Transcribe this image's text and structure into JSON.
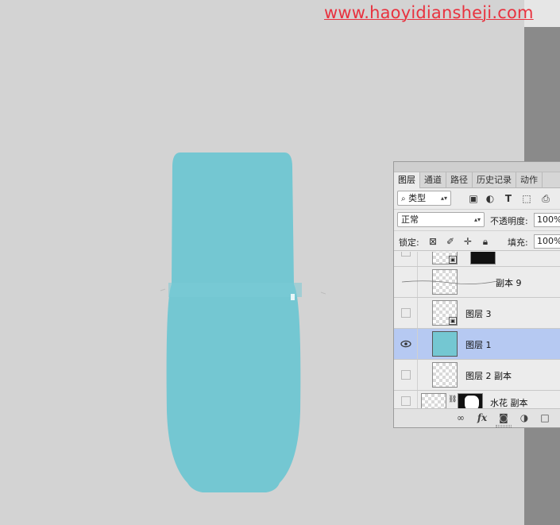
{
  "watermark": "www.haoyidiansheji.com",
  "colors": {
    "bottle": "#74c7d2",
    "selected_layer": "#b6c9f2",
    "watermark": "#e8323f"
  },
  "panel": {
    "tabs": [
      {
        "label": "图层",
        "active": true
      },
      {
        "label": "通道",
        "active": false
      },
      {
        "label": "路径",
        "active": false
      },
      {
        "label": "历史记录",
        "active": false
      },
      {
        "label": "动作",
        "active": false
      }
    ],
    "filter": {
      "kind_label": "类型",
      "icons": [
        "image-filter-icon",
        "adjustment-filter-icon",
        "type-filter-icon",
        "shape-filter-icon",
        "smart-object-filter-icon"
      ]
    },
    "blend_mode": "正常",
    "opacity_label": "不透明度:",
    "opacity_value": "100%",
    "lock_label": "锁定:",
    "fill_label": "填充:",
    "fill_value": "100%",
    "layers": [
      {
        "name": "",
        "visible": false,
        "selected": false,
        "partial": true
      },
      {
        "name": "副本 9",
        "visible": false,
        "selected": false
      },
      {
        "name": "图层 3",
        "visible": false,
        "selected": false
      },
      {
        "name": "图层 1",
        "visible": true,
        "selected": true
      },
      {
        "name": "图层 2 副本",
        "visible": false,
        "selected": false
      },
      {
        "name": "水花 副本",
        "visible": false,
        "selected": false
      }
    ],
    "bottom_icons": [
      "link-layers-icon",
      "fx-icon",
      "add-mask-icon",
      "new-adjustment-icon",
      "new-group-icon"
    ]
  }
}
